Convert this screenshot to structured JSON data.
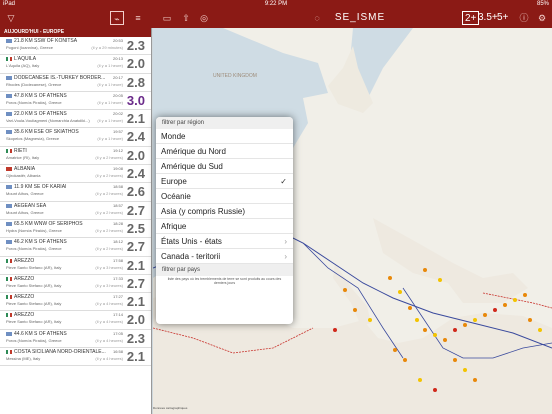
{
  "status": {
    "left": "iPad",
    "center": "9:22 PM",
    "right": "85%"
  },
  "title": "SE_ISME",
  "mag_filters": [
    "2+",
    "3.5+",
    "5+"
  ],
  "section_header": "AUJOURD'HUI - EUROPE",
  "events": [
    {
      "title": "21.8 KM SSW OF KONITSA",
      "region": "Pogoni (Ioannina), Greece",
      "time": "20:53",
      "ago": "(il y a 29 minutes)",
      "mag": "2.3"
    },
    {
      "title": "L'AQUILA",
      "region": "L'Aquila (AQ), Italy",
      "time": "20:13",
      "ago": "(il y a 1 heure)",
      "mag": "2.0"
    },
    {
      "title": "DODECANESE IS.-TURKEY BORDER...",
      "region": "Rhodes (Dodecanese), Greece",
      "time": "20:17",
      "ago": "(il y a 1 heure)",
      "mag": "2.8"
    },
    {
      "title": "47.8 KM S OF ATHENS",
      "region": "Poros (Nomós Piraiós), Greece",
      "time": "20:05",
      "ago": "(il y a 1 heure)",
      "mag": "3.0"
    },
    {
      "title": "22.0 KM S OF ATHENS",
      "region": "Vari-Voula-Vouliagmeni (Nomarchia Anatoliki...)",
      "time": "20:02",
      "ago": "(il y a 1 heure)",
      "mag": "2.1"
    },
    {
      "title": "35.6 KM ESE OF SKIATHOS",
      "region": "Skopelos (Magnesía), Greece",
      "time": "19:57",
      "ago": "(il y a 1 heure)",
      "mag": "2.4"
    },
    {
      "title": "RIETI",
      "region": "Amatrice (RI), Italy",
      "time": "19:12",
      "ago": "(il y a 2 heures)",
      "mag": "2.0"
    },
    {
      "title": "ALBANIA",
      "region": "Gjirokastër, Albania",
      "time": "19:08",
      "ago": "(il y a 2 heures)",
      "mag": "2.4"
    },
    {
      "title": "11.9 KM SE OF KARIAI",
      "region": "Mount Athos, Greece",
      "time": "18:58",
      "ago": "(il y a 2 heures)",
      "mag": "2.6"
    },
    {
      "title": "AEGEAN SEA",
      "region": "Mount Athos, Greece",
      "time": "18:57",
      "ago": "(il y a 2 heures)",
      "mag": "2.7"
    },
    {
      "title": "65.5 KM WNW OF SERIPHOS",
      "region": "Hydra (Nomós Piraiós), Greece",
      "time": "18:28",
      "ago": "(il y a 2 heures)",
      "mag": "2.5"
    },
    {
      "title": "46.2 KM S OF ATHENS",
      "region": "Poros (Nomós Piraiós), Greece",
      "time": "18:12",
      "ago": "(il y a 2 heures)",
      "mag": "2.7"
    },
    {
      "title": "AREZZO",
      "region": "Pieve Santo Stefano (AR), Italy",
      "time": "17:58",
      "ago": "(il y a 3 heures)",
      "mag": "2.1"
    },
    {
      "title": "AREZZO",
      "region": "Pieve Santo Stefano (AR), Italy",
      "time": "17:33",
      "ago": "(il y a 3 heures)",
      "mag": "2.7"
    },
    {
      "title": "AREZZO",
      "region": "Pieve Santo Stefano (AR), Italy",
      "time": "17:27",
      "ago": "(il y a 4 heures)",
      "mag": "2.1"
    },
    {
      "title": "AREZZO",
      "region": "Pieve Santo Stefano (AR), Italy",
      "time": "17:14",
      "ago": "(il y a 4 heures)",
      "mag": "2.0"
    },
    {
      "title": "44.6 KM S OF ATHENS",
      "region": "Poros (Nomós Piraiós), Greece",
      "time": "17:05",
      "ago": "(il y a 4 heures)",
      "mag": "2.3"
    },
    {
      "title": "COSTA SICILIANA NORD-ORIENTALE...",
      "region": "Messina (ME), Italy",
      "time": "16:58",
      "ago": "(il y a 4 heures)",
      "mag": "2.1"
    }
  ],
  "popover": {
    "header": "filtrer par région",
    "regions": [
      "Monde",
      "Amérique du Nord",
      "Amérique du Sud",
      "Europe",
      "Océanie",
      "Asia (y compris Russie)",
      "Afrique",
      "États Unis - états",
      "Canada - teritorii"
    ],
    "selected": "Europe",
    "footer": "filtrer par pays",
    "note": "liste des pays où les tremblements de terre se sont produits au cours des derniers jours"
  },
  "map_labels": {
    "uk": "UNITED KINGDOM",
    "credit": "Données cartographiques"
  }
}
